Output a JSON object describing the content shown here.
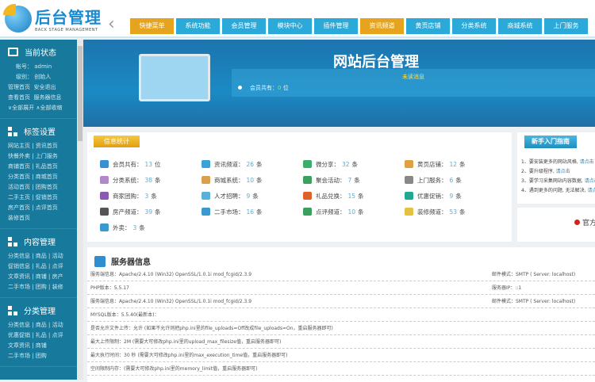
{
  "header": {
    "logo_title": "后台管理",
    "logo_sub": "BACK STAGE MANAGEMENT",
    "nav": [
      {
        "label": "快捷菜单",
        "active": true
      },
      {
        "label": "系统功能"
      },
      {
        "label": "会员管理"
      },
      {
        "label": "模块中心"
      },
      {
        "label": "插件管理"
      },
      {
        "label": "资讯频道",
        "active": true
      },
      {
        "label": "黄页店铺"
      },
      {
        "label": "分类系统"
      },
      {
        "label": "商城系统"
      },
      {
        "label": "上门服务"
      }
    ]
  },
  "sidebar": {
    "status": {
      "title": "当前状态",
      "account": "帐号：  admin",
      "level": "级别：  创始人",
      "links": [
        "管理首页",
        "安全退出",
        "查看首页",
        "服务器信息"
      ],
      "expand": "∨全部展开",
      "collapse": "∧全部收缩"
    },
    "tags": {
      "title": "标签设置",
      "rows": [
        "网站主页 | 资讯首页",
        "快餐外卖 | 上门服务",
        "商铺首页 | 礼品首页",
        "分类首页 | 商城首页",
        "活动首页 | 团购首页",
        "二手主页 | 促销首页",
        "房产首页 | 点评首页",
        "装修首页"
      ]
    },
    "content": {
      "title": "内容管理",
      "rows": [
        "分类信息 | 商品 | 活动",
        "促销信息 | 礼品 | 点评",
        "文章资讯 | 商铺 | 房产",
        "二手市场 | 团购 | 装修"
      ]
    },
    "category": {
      "title": "分类管理",
      "rows": [
        "分类信息 | 商品 | 活动",
        "优惠促销 | 礼品 | 点评",
        "文章资讯 | 商铺",
        "二手市场 | 团购"
      ]
    }
  },
  "banner": {
    "title": "网站后台管理",
    "unread": "未读消息",
    "members": "会员共有：",
    "members_count": "0",
    "members_unit": "位"
  },
  "stats": {
    "title": "信息统计",
    "items": [
      {
        "label": "会员共有：",
        "count": "13",
        "unit": "位",
        "icon": "toggle-icon",
        "color": "#3a8fd0"
      },
      {
        "label": "资讯频道：",
        "count": "26",
        "unit": "条",
        "icon": "news-icon",
        "color": "#3aa0d8"
      },
      {
        "label": "微分享：",
        "count": "32",
        "unit": "条",
        "icon": "share-icon",
        "color": "#3cae6a"
      },
      {
        "label": "黄页店铺：",
        "count": "12",
        "unit": "条",
        "icon": "book-icon",
        "color": "#e0a040"
      },
      {
        "label": "分类系统：",
        "count": "38",
        "unit": "条",
        "icon": "flower-icon",
        "color": "#b08ac8"
      },
      {
        "label": "商城系统：",
        "count": "10",
        "unit": "条",
        "icon": "shop-icon",
        "color": "#d9a050"
      },
      {
        "label": "聚会活动：",
        "count": "7",
        "unit": "条",
        "icon": "people-icon",
        "color": "#3ca060"
      },
      {
        "label": "上门服务：",
        "count": "6",
        "unit": "条",
        "icon": "doc-icon",
        "color": "#888888"
      },
      {
        "label": "商家团购：",
        "count": "3",
        "unit": "条",
        "icon": "group-icon",
        "color": "#8a5cb0"
      },
      {
        "label": "人才招聘：",
        "count": "9",
        "unit": "条",
        "icon": "globe-icon",
        "color": "#5ab0d8"
      },
      {
        "label": "礼品兑换：",
        "count": "15",
        "unit": "条",
        "icon": "gift-icon",
        "color": "#e0602a"
      },
      {
        "label": "优惠促销：",
        "count": "9",
        "unit": "条",
        "icon": "discount-icon",
        "color": "#20a890"
      },
      {
        "label": "房产频道：",
        "count": "39",
        "unit": "条",
        "icon": "building-icon",
        "color": "#555555"
      },
      {
        "label": "二手市场：",
        "count": "16",
        "unit": "条",
        "icon": "recycle-icon",
        "color": "#3a9ad0"
      },
      {
        "label": "点评频道：",
        "count": "10",
        "unit": "条",
        "icon": "cup-icon",
        "color": "#3aa060"
      },
      {
        "label": "装修频道：",
        "count": "53",
        "unit": "条",
        "icon": "roller-icon",
        "color": "#e8c040"
      },
      {
        "label": "外卖：",
        "count": "3",
        "unit": "条",
        "icon": "recycle-icon",
        "color": "#3a9ad0"
      }
    ]
  },
  "guide": {
    "title": "新手入门指南",
    "items": [
      {
        "text": "1、要安装更多的网站风格, ",
        "link": "请点击"
      },
      {
        "text": "2、要升级程序, ",
        "link": "请点击"
      },
      {
        "text": "3、要学习采集网站内容数据, ",
        "link": "请点击"
      },
      {
        "text": "4、遇到更多的问题, 无法解决, ",
        "link": "请点击"
      }
    ]
  },
  "official": "官方",
  "server": {
    "title": "服务器信息",
    "rows": [
      {
        "left": "服务端信息：Apache/2.4.10 (Win32) OpenSSL/1.0.1i mod_fcgid/2.3.9",
        "right": "邮件模式：SMTP ( Server: localhost)"
      },
      {
        "left": "PHP版本：5.5.17",
        "right": "服务器IP：::1"
      },
      {
        "left": "服务端信息：Apache/2.4.10 (Win32) OpenSSL/1.0.1i mod_fcgid/2.3.9",
        "right": "邮件模式：SMTP ( Server: localhost)"
      },
      {
        "left": "MYSQL版本：5.5.40(最新本)：",
        "right": ""
      },
      {
        "left": "是否允许文件上传：允许 (如果不允许则把php.ini里的file_uploads=Off改成file_uploads=On，重启服务器即可)",
        "right": ""
      },
      {
        "left": "最大上传限制：2M (需要大可修改php.ini里的upload_max_filesize值，重启服务器即可)",
        "right": ""
      },
      {
        "left": "最大执行时间：30 秒 (需要大可修改php.ini里的max_execution_time值，重启服务器即可)",
        "right": ""
      },
      {
        "left": "空间限制内存：(需要大可修改php.ini里的memory_limit值，重启服务器即可)",
        "right": ""
      }
    ]
  }
}
